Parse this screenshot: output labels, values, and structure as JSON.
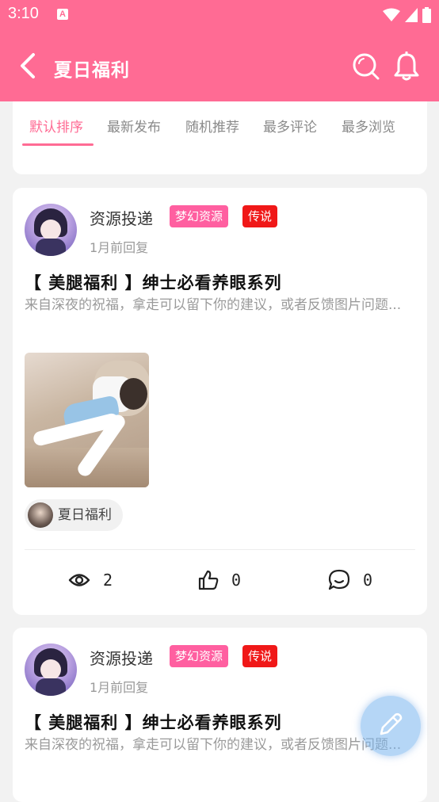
{
  "status_bar": {
    "time": "3:10",
    "notification_icon": "a-notification-icon",
    "wifi_icon": "wifi-icon",
    "signal_icon": "signal-icon",
    "battery_icon": "battery-icon"
  },
  "app_bar": {
    "title": "夏日福利",
    "back_icon": "back-arrow-icon",
    "search_icon": "search-icon",
    "bell_icon": "bell-icon"
  },
  "tabs": [
    {
      "label": "默认排序",
      "active": true
    },
    {
      "label": "最新发布",
      "active": false
    },
    {
      "label": "随机推荐",
      "active": false
    },
    {
      "label": "最多评论",
      "active": false
    },
    {
      "label": "最多浏览",
      "active": false
    }
  ],
  "posts": [
    {
      "author": "资源投递",
      "badges": [
        "梦幻资源",
        "传说"
      ],
      "time": "1月前回复",
      "title": "【 美腿福利 】绅士必看养眼系列",
      "desc": "来自深夜的祝福，拿走可以留下你的建议，或者反馈图片问题...",
      "topic": "夏日福利",
      "views": "2",
      "likes": "0",
      "comments": "0"
    },
    {
      "author": "资源投递",
      "badges": [
        "梦幻资源",
        "传说"
      ],
      "time": "1月前回复",
      "title": "【 美腿福利 】绅士必看养眼系列",
      "desc": "来自深夜的祝福，拿走可以留下你的建议，或者反馈图片问题..."
    }
  ],
  "fab": {
    "icon": "edit-pencil-icon"
  },
  "colors": {
    "brand": "#ff6b94",
    "badge_fantasy": "#ff5fa0",
    "badge_legend": "#f01818",
    "fab": "#78b4ee"
  }
}
